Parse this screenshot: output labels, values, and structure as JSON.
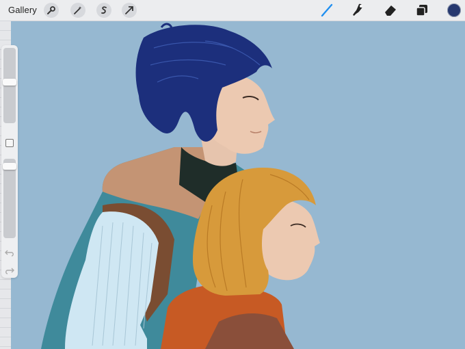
{
  "toolbar": {
    "gallery_label": "Gallery",
    "left_tools": [
      "wrench-icon",
      "magic-wand-icon",
      "selection-s-icon",
      "transform-arrow-icon"
    ],
    "right_tools": [
      "brush-icon",
      "smudge-icon",
      "eraser-icon",
      "layers-icon"
    ],
    "active_tool": "brush-icon",
    "current_color": "#26386f"
  },
  "sidebar": {
    "brush_size_level": 0.21,
    "opacity_level": 0.16
  },
  "colors": {
    "canvas_background": "#96b8d1",
    "accent_blue": "#1f8ff0"
  }
}
